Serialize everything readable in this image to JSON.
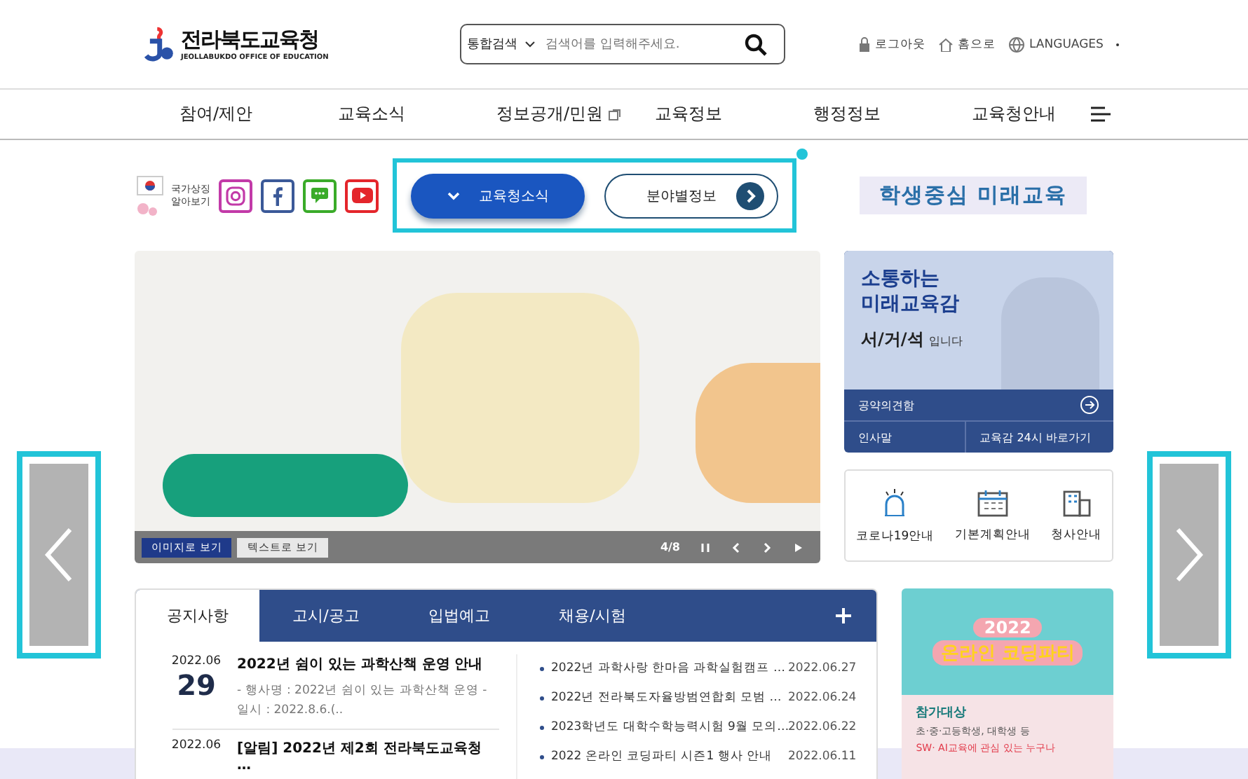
{
  "header": {
    "logo": {
      "name": "전라북도교육청",
      "subtitle": "JEOLLABUKDO OFFICE OF EDUCATION"
    },
    "search": {
      "scope": "통합검색",
      "placeholder": "검색어를 입력해주세요."
    },
    "utility_links": [
      {
        "label": "로그아웃",
        "kind": "lock"
      },
      {
        "label": "홈으로",
        "kind": "home"
      },
      {
        "label": "LANGUAGES",
        "kind": "globe"
      }
    ]
  },
  "nav": {
    "items": [
      {
        "label": "참여/제안",
        "external": false
      },
      {
        "label": "교육소식",
        "external": false
      },
      {
        "label": "정보공개/민원",
        "external": true
      },
      {
        "label": "교육정보",
        "external": false
      },
      {
        "label": "행정정보",
        "external": false
      },
      {
        "label": "교육청안내",
        "external": false
      }
    ]
  },
  "quick_row": {
    "symbol_link": "국가상징 알아보기",
    "social": [
      {
        "kind": "instagram"
      },
      {
        "kind": "facebook"
      },
      {
        "kind": "talk"
      },
      {
        "kind": "youtube"
      }
    ],
    "segments": [
      {
        "label": "교육청소식",
        "selected": true
      },
      {
        "label": "분야별정보",
        "selected": false
      }
    ],
    "slogan": "학생중심 미래교육"
  },
  "banner": {
    "view_buttons": [
      {
        "label": "이미지로 보기",
        "selected": true
      },
      {
        "label": "텍스트로 보기",
        "selected": false
      }
    ],
    "counter": "4/8"
  },
  "profile": {
    "headline": [
      "소통하는",
      "미래교육감"
    ],
    "name": "서/거/석",
    "suffix": "입니다",
    "main_link": "공약의견함",
    "links": [
      "인사말",
      "교육감 24시 바로가기"
    ]
  },
  "quick_links": [
    {
      "label": "코로나19안내",
      "kind": "siren"
    },
    {
      "label": "기본계획안내",
      "kind": "calendar"
    },
    {
      "label": "청사안내",
      "kind": "building"
    }
  ],
  "notices": {
    "tabs": [
      {
        "label": "공지사항",
        "selected": true
      },
      {
        "label": "고시/공고",
        "selected": false
      },
      {
        "label": "입법예고",
        "selected": false
      },
      {
        "label": "채용/시험",
        "selected": false
      }
    ],
    "featured": [
      {
        "month": "2022.06",
        "day": "29",
        "title": "2022년 쉼이 있는 과학산책 운영 안내",
        "summary": "- 행사명 : 2022년 쉼이 있는 과학산책 운영 - 일시 : 2022.8.6.(.."
      },
      {
        "month": "2022.06",
        "title": "[알림] 2022년 제2회 전라북도교육청 …"
      }
    ],
    "list": [
      {
        "title": "2022년 과학사랑 한마음 과학실험캠프 …",
        "date": "2022.06.27"
      },
      {
        "title": "2022년 전라북도자율방범연합회 모범 …",
        "date": "2022.06.24"
      },
      {
        "title": "2023학년도 대학수학능력시험 9월 모의…",
        "date": "2022.06.22"
      },
      {
        "title": "2022 온라인 코딩파티 시즌1 행사 안내",
        "date": "2022.06.11"
      }
    ]
  },
  "promo": {
    "year": "2022",
    "title": "온라인 코딩파티",
    "section": "참가대상",
    "lines": [
      "초·중·고등학생, 대학생 등",
      "SW· AI교육에 관심 있는 누구나"
    ]
  }
}
